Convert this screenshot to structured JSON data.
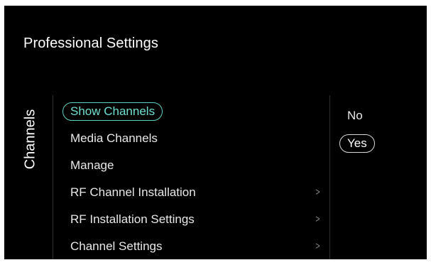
{
  "header": {
    "title": "Professional Settings"
  },
  "side_tab": {
    "label": "Channels"
  },
  "menu": {
    "items": [
      {
        "label": "Show Channels",
        "state": "focused",
        "has_submenu": false
      },
      {
        "label": "Media Channels",
        "state": "normal",
        "has_submenu": false
      },
      {
        "label": "Manage",
        "state": "normal",
        "has_submenu": false
      },
      {
        "label": "RF Channel Installation",
        "state": "normal",
        "has_submenu": true
      },
      {
        "label": "RF Installation Settings",
        "state": "normal",
        "has_submenu": true
      },
      {
        "label": "Channel Settings",
        "state": "normal",
        "has_submenu": true
      }
    ],
    "chevron_icon": "chevron-right-icon",
    "chevron_glyph": ">"
  },
  "options": {
    "items": [
      {
        "label": "No",
        "selected": false
      },
      {
        "label": "Yes",
        "selected": true
      }
    ]
  },
  "colors": {
    "background": "#000000",
    "focus_accent": "#5ed1c4",
    "selected_outline": "#d8d8d8",
    "text": "#e8e8e8",
    "chevron": "#8a8a8a"
  }
}
